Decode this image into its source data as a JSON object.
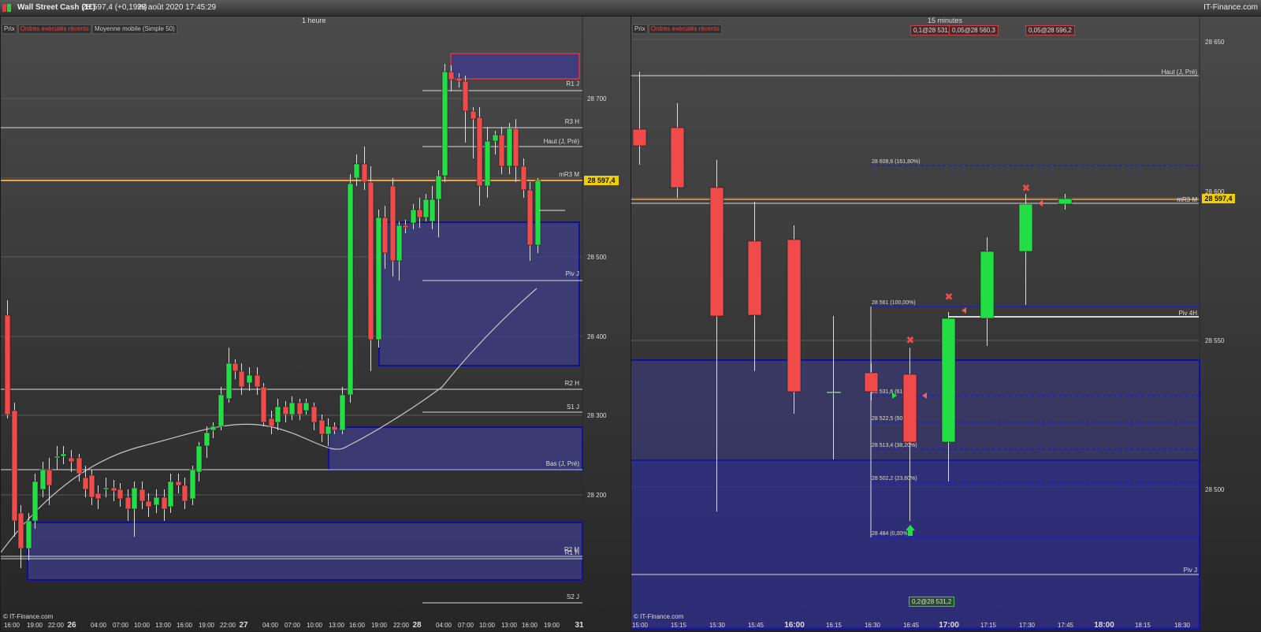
{
  "header": {
    "instrument": "Wall Street Cash (1€)",
    "price_change": "28 597,4 (+0,19%)",
    "datetime": "28 août 2020 17:45:29",
    "brand": "IT-Finance.com"
  },
  "left_chart": {
    "timeframe": "1 heure",
    "tabs": [
      "Prix",
      "Ordres exécutés récents",
      "Moyenne mobile (Simple 50)"
    ],
    "watermark": "© IT-Finance.com",
    "price_tag": "28 597,4",
    "y_ticks": [
      "28 700",
      "28 500",
      "28 400",
      "28 300",
      "28 200"
    ],
    "x_ticks": [
      "16:00",
      "19:00",
      "22:00",
      "26",
      "04:00",
      "07:00",
      "10:00",
      "13:00",
      "16:00",
      "19:00",
      "22:00",
      "27",
      "04:00",
      "07:00",
      "10:00",
      "13:00",
      "16:00",
      "19:00",
      "22:00",
      "28",
      "04:00",
      "07:00",
      "10:00",
      "13:00",
      "16:00",
      "19:00",
      "31"
    ],
    "level_labels": [
      "R1 J",
      "R3 H",
      "Haut (J, Pré)",
      "mR3 M",
      "Piv J",
      "R2 H",
      "S1 J",
      "Bas (J, Pré)",
      "R2 M",
      "R1 H",
      "S2 J"
    ]
  },
  "right_chart": {
    "timeframe": "15 minutes",
    "tabs": [
      "Prix",
      "Ordres exécutés récents"
    ],
    "order_badges": [
      "0,1@28 531,8",
      "0,05@28 560,3",
      "0,05@28 596,2"
    ],
    "bottom_badge": "0,2@28 531,2",
    "watermark": "© IT-Finance.com",
    "price_tag": "28 597,4",
    "y_ticks": [
      "28 650",
      "28 600",
      "28 550",
      "28 500"
    ],
    "x_ticks": [
      "15:00",
      "15:15",
      "15:30",
      "15:45",
      "16:00",
      "16:15",
      "16:30",
      "16:45",
      "17:00",
      "17:15",
      "17:30",
      "17:45",
      "18:00",
      "18:15",
      "18:30"
    ],
    "level_labels": [
      "Haut (J, Pré)",
      "mR3 M",
      "Piv 4H",
      "Piv J"
    ],
    "fib_labels": [
      "28 608,6 (161,80%)",
      "28 561 (100,00%)",
      "28 531,6 (61,80%)",
      "28 522,5 (50,00%)",
      "28 513,4 (38,20%)",
      "28 502,2 (23,60%)",
      "28 484 (0,00%)"
    ]
  },
  "colors": {
    "bull": "#22dd44",
    "bear": "#f04a4a",
    "zone": "#3d3d8a",
    "price_line": "#f0a040",
    "price_tag_bg": "#f0d000"
  }
}
